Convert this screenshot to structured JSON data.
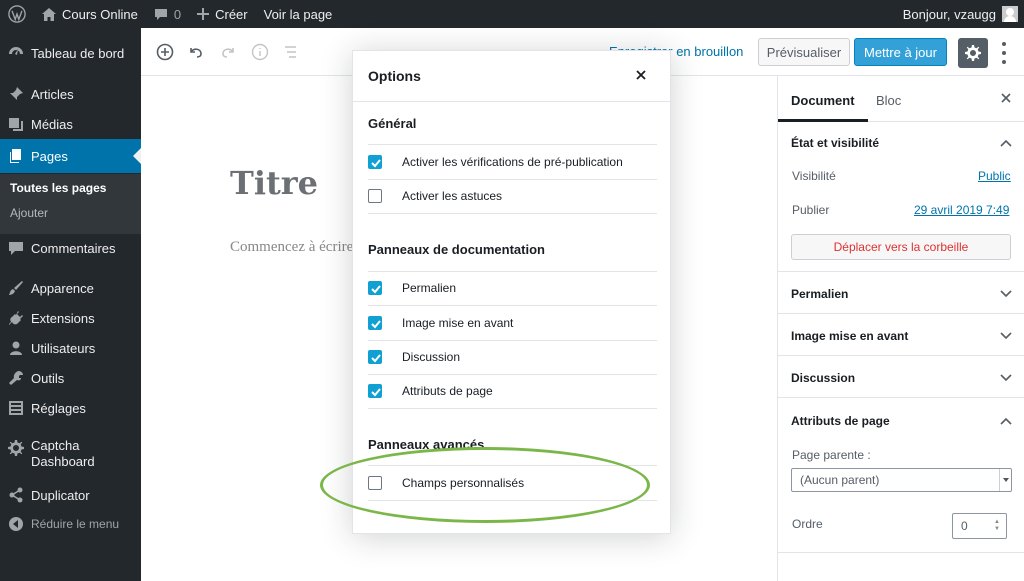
{
  "adminbar": {
    "site_name": "Cours Online",
    "comments_count": "0",
    "create_label": "Créer",
    "view_page_label": "Voir la page",
    "greeting": "Bonjour, vzaugg"
  },
  "sidebar": {
    "items": [
      {
        "label": "Tableau de bord",
        "icon": "dashboard-icon"
      },
      {
        "label": "Articles",
        "icon": "pin-icon"
      },
      {
        "label": "Médias",
        "icon": "media-icon"
      },
      {
        "label": "Pages",
        "icon": "pages-icon"
      },
      {
        "label": "Commentaires",
        "icon": "comments-icon"
      },
      {
        "label": "Apparence",
        "icon": "brush-icon"
      },
      {
        "label": "Extensions",
        "icon": "plugin-icon"
      },
      {
        "label": "Utilisateurs",
        "icon": "users-icon"
      },
      {
        "label": "Outils",
        "icon": "wrench-icon"
      },
      {
        "label": "Réglages",
        "icon": "settings-icon"
      },
      {
        "label": "Captcha\nDashboard",
        "icon": "gear-icon"
      },
      {
        "label": "Duplicator",
        "icon": "share-icon"
      }
    ],
    "submenu": [
      "Toutes les pages",
      "Ajouter"
    ],
    "collapse_label": "Réduire le menu"
  },
  "toolbar": {
    "save_draft_label": "Enregistrer en brouillon",
    "preview_label": "Prévisualiser",
    "publish_label": "Mettre à jour"
  },
  "editor": {
    "title": "Titre",
    "placeholder": "Commencez à écrire ou tapez / pour choisir un bloc"
  },
  "panel": {
    "tab_document": "Document",
    "tab_block": "Bloc",
    "status_title": "État et visibilité",
    "visibility_label": "Visibilité",
    "visibility_value": "Public",
    "publish_label": "Publier",
    "publish_value": "29 avril 2019 7:49",
    "trash_label": "Déplacer vers la corbeille",
    "permalink_title": "Permalien",
    "featured_title": "Image mise en avant",
    "discussion_title": "Discussion",
    "attributes_title": "Attributs de page",
    "parent_label": "Page parente :",
    "parent_value": "(Aucun parent)",
    "order_label": "Ordre",
    "order_value": "0"
  },
  "modal": {
    "title": "Options",
    "general_title": "Général",
    "general_options": [
      {
        "label": "Activer les vérifications de pré-publication",
        "checked": true
      },
      {
        "label": "Activer les astuces",
        "checked": false
      }
    ],
    "doc_title": "Panneaux de documentation",
    "doc_options": [
      {
        "label": "Permalien",
        "checked": true
      },
      {
        "label": "Image mise en avant",
        "checked": true
      },
      {
        "label": "Discussion",
        "checked": true
      },
      {
        "label": "Attributs de page",
        "checked": true
      }
    ],
    "advanced_title": "Panneaux avancés",
    "advanced_options": [
      {
        "label": "Champs personnalisés",
        "checked": false
      }
    ]
  },
  "colors": {
    "accent": "#0073aa",
    "checkbox": "#11a0d2",
    "highlight": "#7ab648"
  }
}
